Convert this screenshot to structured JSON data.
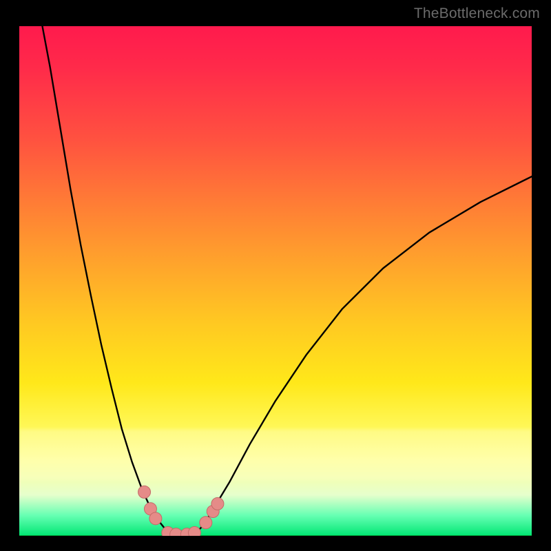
{
  "watermark": {
    "text": "TheBottleneck.com"
  },
  "colors": {
    "curve": "#000000",
    "marker_fill": "#e58b88",
    "marker_stroke": "#c46a67",
    "green_line": "#00a63b"
  },
  "chart_data": {
    "type": "line",
    "title": "",
    "xlabel": "",
    "ylabel": "",
    "xlim": [
      0,
      100
    ],
    "ylim": [
      0,
      100
    ],
    "grid": false,
    "series": [
      {
        "name": "left-branch",
        "x": [
          4.5,
          6,
          8,
          10,
          12,
          14,
          16,
          18,
          20,
          22,
          24,
          25.6,
          27,
          28.5,
          30
        ],
        "y": [
          100,
          92,
          80,
          68,
          57,
          47,
          37.5,
          29,
          21,
          14.5,
          9,
          5.5,
          3.2,
          1.3,
          0
        ]
      },
      {
        "name": "right-branch",
        "x": [
          34,
          36,
          38,
          41,
          45,
          50,
          56,
          63,
          71,
          80,
          90,
          100
        ],
        "y": [
          0,
          2.2,
          5.5,
          10.5,
          18,
          26.5,
          35.5,
          44.5,
          52.5,
          59.5,
          65.5,
          70.5
        ]
      },
      {
        "name": "flat-bottom",
        "x": [
          30,
          31.5,
          33,
          34
        ],
        "y": [
          0,
          0,
          0,
          0
        ]
      }
    ],
    "markers": [
      {
        "x": 24.4,
        "y": 8.6
      },
      {
        "x": 25.6,
        "y": 5.3
      },
      {
        "x": 26.6,
        "y": 3.4
      },
      {
        "x": 29.0,
        "y": 0.6
      },
      {
        "x": 30.6,
        "y": 0.3
      },
      {
        "x": 32.7,
        "y": 0.3
      },
      {
        "x": 34.2,
        "y": 0.6
      },
      {
        "x": 36.4,
        "y": 2.6
      },
      {
        "x": 37.8,
        "y": 4.8
      },
      {
        "x": 38.7,
        "y": 6.3
      }
    ],
    "baseline_y": 0
  }
}
